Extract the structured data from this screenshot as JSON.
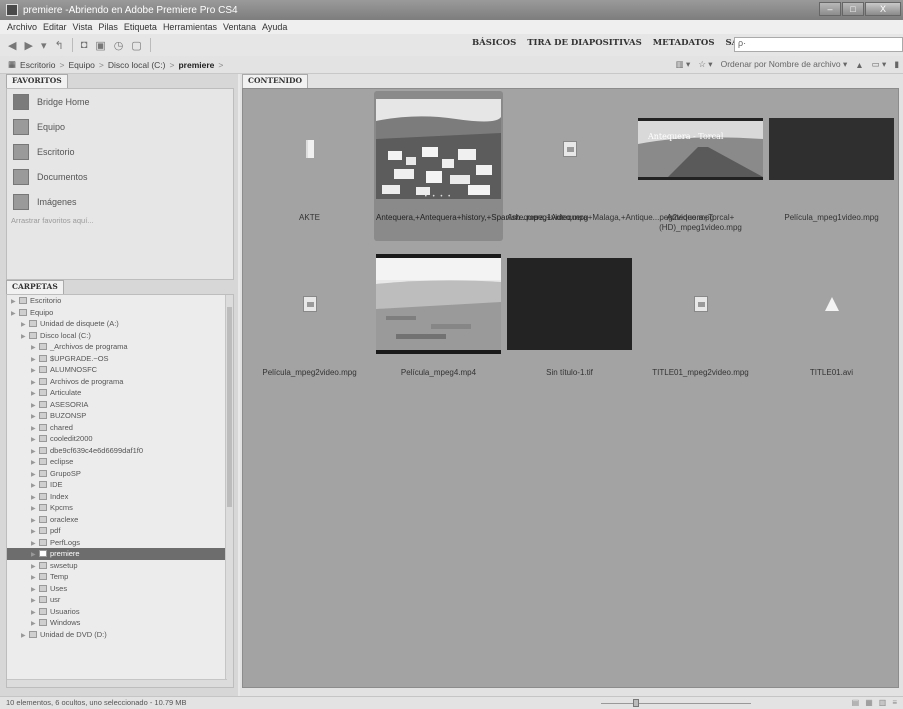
{
  "window": {
    "title": "premiere -Abriendo en Adobe Premiere Pro CS4",
    "buttons": [
      "–",
      "□",
      "X"
    ]
  },
  "menu": [
    "Archivo",
    "Editar",
    "Vista",
    "Pilas",
    "Etiqueta",
    "Herramientas",
    "Ventana",
    "Ayuda"
  ],
  "toolbar": {
    "workspaces": [
      "BÁSICOS",
      "TIRA DE DIAPOSITIVAS",
      "METADATOS",
      "SALIDA"
    ],
    "workspace_arrow": "▼",
    "search_placeholder": "ρ·"
  },
  "path": {
    "crumbs": [
      "Escritorio",
      "Equipo",
      "Disco local (C:)",
      "premiere"
    ],
    "separator": ">",
    "sort_label": "Ordenar por Nombre de archivo ▾"
  },
  "favorites": {
    "tab": "FAVORITOS",
    "items": [
      {
        "label": "Bridge Home",
        "icon": "home-icon"
      },
      {
        "label": "Equipo",
        "icon": "computer-icon"
      },
      {
        "label": "Escritorio",
        "icon": "desktop-icon"
      },
      {
        "label": "Documentos",
        "icon": "documents-icon"
      },
      {
        "label": "Imágenes",
        "icon": "pictures-icon"
      }
    ],
    "drag_hint": "Arrastrar favoritos aquí..."
  },
  "folders": {
    "tab": "CARPETAS",
    "rows": [
      {
        "label": "Escritorio",
        "depth": 0
      },
      {
        "label": "Equipo",
        "depth": 0
      },
      {
        "label": "Unidad de disquete (A:)",
        "depth": 1
      },
      {
        "label": "Disco local (C:)",
        "depth": 1
      },
      {
        "label": "_Archivos de programa",
        "depth": 2
      },
      {
        "label": "$UPGRADE.~OS",
        "depth": 2
      },
      {
        "label": "ALUMNOSFC",
        "depth": 2
      },
      {
        "label": "Archivos de programa",
        "depth": 2
      },
      {
        "label": "Articulate",
        "depth": 2
      },
      {
        "label": "ASESORIA",
        "depth": 2
      },
      {
        "label": "BUZONSP",
        "depth": 2
      },
      {
        "label": "chared",
        "depth": 2
      },
      {
        "label": "cooledit2000",
        "depth": 2
      },
      {
        "label": "dbe9cf639c4e6d6699daf1f0",
        "depth": 2
      },
      {
        "label": "eclipse",
        "depth": 2
      },
      {
        "label": "GrupoSP",
        "depth": 2
      },
      {
        "label": "IDE",
        "depth": 2
      },
      {
        "label": "Index",
        "depth": 2
      },
      {
        "label": "Kpcms",
        "depth": 2
      },
      {
        "label": "oraclexe",
        "depth": 2
      },
      {
        "label": "pdf",
        "depth": 2
      },
      {
        "label": "PerfLogs",
        "depth": 2
      },
      {
        "label": "premiere",
        "depth": 2
      },
      {
        "label": "swsetup",
        "depth": 2
      },
      {
        "label": "Temp",
        "depth": 2
      },
      {
        "label": "Uses",
        "depth": 2
      },
      {
        "label": "usr",
        "depth": 2
      },
      {
        "label": "Usuarios",
        "depth": 2
      },
      {
        "label": "Windows",
        "depth": 2
      },
      {
        "label": "Unidad de DVD (D:)",
        "depth": 1
      }
    ],
    "selected": "premiere"
  },
  "content": {
    "tab": "CONTENIDO",
    "items": [
      {
        "label": "AKTE",
        "kind": "folder"
      },
      {
        "label": "Antequera,+Antequera+history,+Spanish...mpeg1video.mpg",
        "kind": "photo-town",
        "selected": true
      },
      {
        "label": "Antequera,+Antequera+Malaga,+Antique...peg2video.mpg",
        "kind": "file"
      },
      {
        "label": "Antequera+Torcal+(HD)_mpeg1video.mpg",
        "kind": "video-road",
        "overlay": "Antequera - Torcal"
      },
      {
        "label": "Película_mpeg1video.mpg",
        "kind": "video-dark"
      },
      {
        "label": "Película_mpeg2video.mpg",
        "kind": "file"
      },
      {
        "label": "Película_mpeg4.mp4",
        "kind": "photo-plain"
      },
      {
        "label": "Sin título-1.tif",
        "kind": "black"
      },
      {
        "label": "TITLE01_mpeg2video.mpg",
        "kind": "file"
      },
      {
        "label": "TITLE01.avi",
        "kind": "vlc"
      }
    ]
  },
  "status": {
    "text": "10 elementos, 6 ocultos, uno seleccionado - 10.79 MB"
  }
}
